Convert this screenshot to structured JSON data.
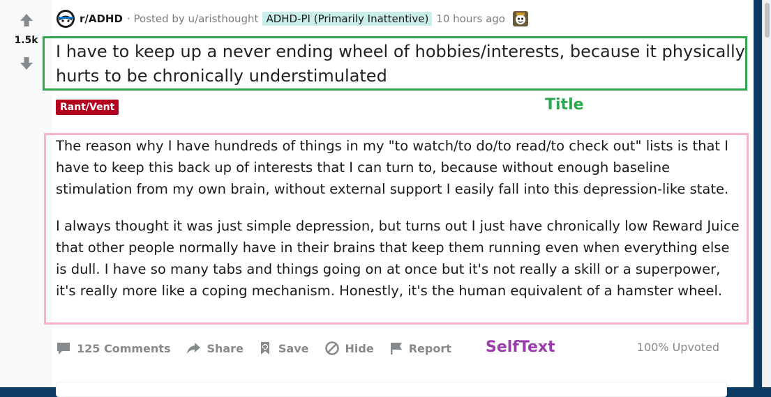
{
  "post": {
    "subreddit": "r/ADHD",
    "posted_by": "· Posted by u/aristhought",
    "user_flair": "ADHD-PI (Primarily Inattentive)",
    "time": "10 hours ago",
    "vote_count": "1.5k",
    "title": "I have to keep up a never ending wheel of hobbies/interests, because it physically hurts to be chronically understimulated",
    "post_flair": "Rant/Vent",
    "selftext": [
      "The reason why I have hundreds of things in my \"to watch/to do/to read/to check out\" lists is that I have to keep this back up of interests that I can turn to, because without enough baseline stimulation from my own brain, without external support I easily fall into this depression-like state.",
      "I always thought it was just simple depression, but turns out I just have chronically low Reward Juice that other people normally have in their brains that keep them running even when everything else is dull. I have so many tabs and things going on at once but it's not really a skill or a superpower, it's really more like a coping mechanism. Honestly, it's the human equivalent of a hamster wheel."
    ],
    "upvote_ratio": "100% Upvoted"
  },
  "actions": {
    "comments": "125 Comments",
    "share": "Share",
    "save": "Save",
    "hide": "Hide",
    "report": "Report"
  },
  "annotations": {
    "title_label": "Title",
    "selftext_label": "SelfText"
  },
  "colors": {
    "title_box": "#2ea84f",
    "selftext_box": "#f6b3c9",
    "flair": "#b3001e",
    "user_flair_bg": "#c9ede8",
    "selftext_label": "#9b3dac"
  },
  "icons": {
    "upvote": "arrow-up-icon",
    "downvote": "arrow-down-icon",
    "subreddit": "subreddit-icon",
    "award": "award-icon",
    "comments": "comment-bubble-icon",
    "share": "share-arrow-icon",
    "save": "bookmark-plus-icon",
    "hide": "hide-circle-slash-icon",
    "report": "flag-icon"
  }
}
